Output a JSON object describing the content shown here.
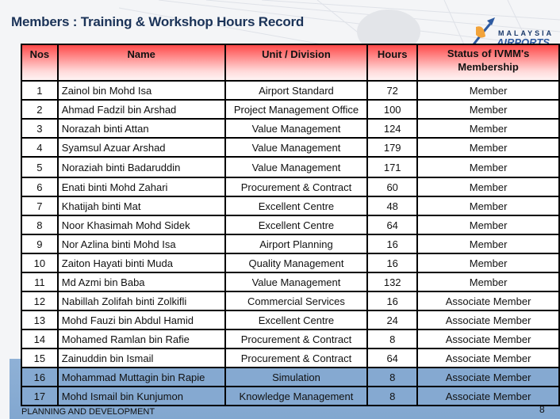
{
  "slide": {
    "title": "Members : Training & Workshop Hours Record",
    "logo": {
      "line1": "MALAYSIA",
      "line2": "AIRPORTS",
      "icon": "plane-tower-logo-icon"
    },
    "footer_text": "PLANNING AND DEVELOPMENT",
    "page_number": "8",
    "colors": {
      "title": "#1b3358",
      "header_gradient_top": "#ff4a4a",
      "header_gradient_bottom": "#fff3f3",
      "band_blue": "#85a9d1"
    }
  },
  "table": {
    "headers": {
      "nos": "Nos",
      "name": "Name",
      "unit": "Unit / Division",
      "hours": "Hours",
      "status": "Status of IVMM's Membership"
    },
    "rows": [
      {
        "nos": "1",
        "name": "Zainol bin Mohd Isa",
        "unit": "Airport Standard",
        "hours": "72",
        "status": "Member"
      },
      {
        "nos": "2",
        "name": "Ahmad Fadzil bin Arshad",
        "unit": "Project Management Office",
        "hours": "100",
        "status": "Member"
      },
      {
        "nos": "3",
        "name": "Norazah binti Attan",
        "unit": "Value Management",
        "hours": "124",
        "status": "Member"
      },
      {
        "nos": "4",
        "name": "Syamsul Azuar Arshad",
        "unit": "Value Management",
        "hours": "179",
        "status": "Member"
      },
      {
        "nos": "5",
        "name": "Noraziah binti Badaruddin",
        "unit": "Value Management",
        "hours": "171",
        "status": "Member"
      },
      {
        "nos": "6",
        "name": "Enati binti Mohd Zahari",
        "unit": "Procurement & Contract",
        "hours": "60",
        "status": "Member"
      },
      {
        "nos": "7",
        "name": "Khatijah binti Mat",
        "unit": "Excellent Centre",
        "hours": "48",
        "status": "Member"
      },
      {
        "nos": "8",
        "name": "Noor Khasimah Mohd Sidek",
        "unit": "Excellent Centre",
        "hours": "64",
        "status": "Member"
      },
      {
        "nos": "9",
        "name": "Nor Azlina binti Mohd Isa",
        "unit": "Airport Planning",
        "hours": "16",
        "status": "Member"
      },
      {
        "nos": "10",
        "name": "Zaiton Hayati binti Muda",
        "unit": "Quality Management",
        "hours": "16",
        "status": "Member"
      },
      {
        "nos": "11",
        "name": "Md Azmi bin Baba",
        "unit": "Value Management",
        "hours": "132",
        "status": "Member"
      },
      {
        "nos": "12",
        "name": "Nabillah Zolifah binti Zolkifli",
        "unit": "Commercial Services",
        "hours": "16",
        "status": "Associate Member"
      },
      {
        "nos": "13",
        "name": "Mohd Fauzi bin Abdul Hamid",
        "unit": "Excellent Centre",
        "hours": "24",
        "status": "Associate Member"
      },
      {
        "nos": "14",
        "name": "Mohamed Ramlan bin Rafie",
        "unit": "Procurement & Contract",
        "hours": "8",
        "status": "Associate Member"
      },
      {
        "nos": "15",
        "name": "Zainuddin bin Ismail",
        "unit": "Procurement & Contract",
        "hours": "64",
        "status": "Associate Member"
      },
      {
        "nos": "16",
        "name": "Mohammad Muttagin bin Rapie",
        "unit": "Simulation",
        "hours": "8",
        "status": "Associate Member"
      },
      {
        "nos": "17",
        "name": "Mohd Ismail bin Kunjumon",
        "unit": "Knowledge Management",
        "hours": "8",
        "status": "Associate Member"
      }
    ]
  }
}
